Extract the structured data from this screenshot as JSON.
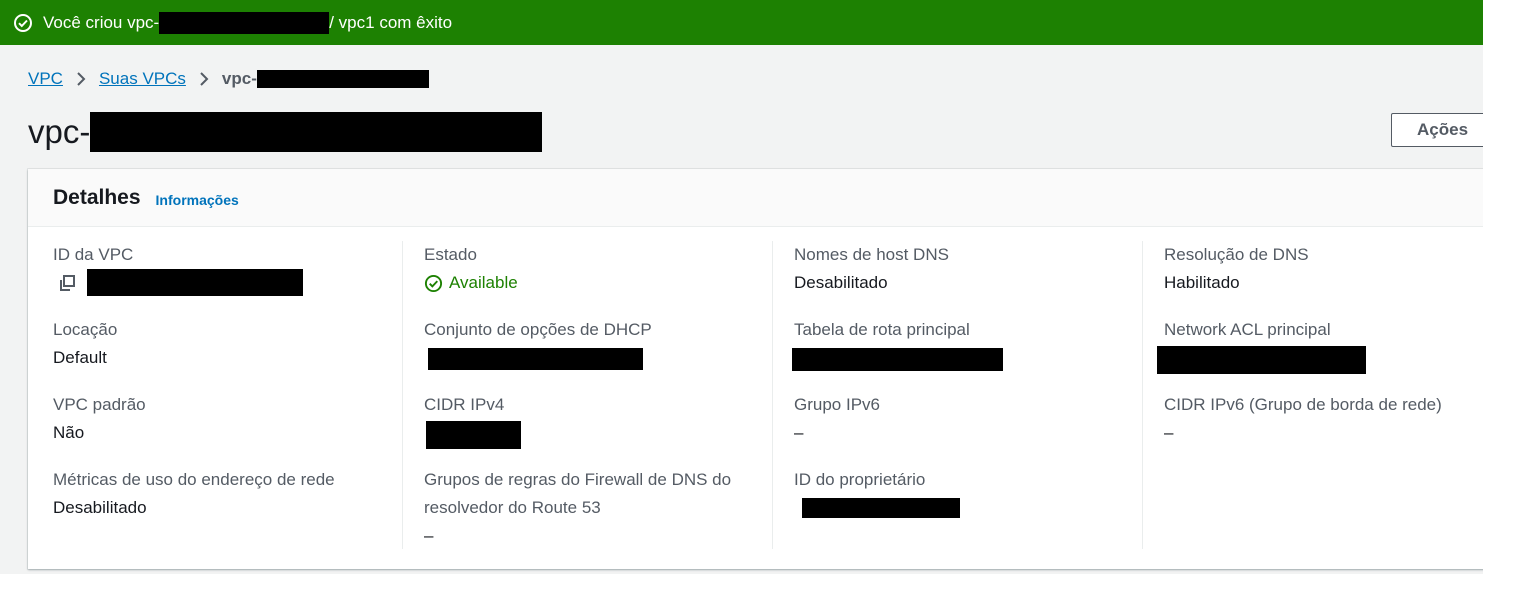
{
  "flash": {
    "prefix": "Você criou vpc-",
    "suffix": "/ vpc1 com êxito",
    "icon": "check-circle-icon",
    "background": "#1d8102"
  },
  "breadcrumb": {
    "items": [
      "VPC",
      "Suas VPCs"
    ],
    "current_prefix": "vpc-"
  },
  "page": {
    "title_prefix": "vpc-",
    "actions_label": "Ações"
  },
  "details": {
    "heading": "Detalhes",
    "info_link": "Informações",
    "fields": {
      "vpc_id": {
        "label": "ID da VPC"
      },
      "tenancy": {
        "label": "Locação",
        "value": "Default"
      },
      "default_vpc": {
        "label": "VPC padrão",
        "value": "Não"
      },
      "usage_metrics": {
        "label": "Métricas de uso do endereço de rede",
        "value": "Desabilitado"
      },
      "state": {
        "label": "Estado",
        "value": "Available",
        "color": "#1d8102"
      },
      "dhcp_options": {
        "label": "Conjunto de opções de DHCP"
      },
      "cidr_ipv4": {
        "label": "CIDR IPv4"
      },
      "route53_firewall": {
        "label": "Grupos de regras do Firewall de DNS do resolvedor do Route 53",
        "value": "–"
      },
      "dns_hostnames": {
        "label": "Nomes de host DNS",
        "value": "Desabilitado"
      },
      "main_route_table": {
        "label": "Tabela de rota principal"
      },
      "ipv6_pool": {
        "label": "Grupo IPv6",
        "value": "–"
      },
      "owner_id": {
        "label": "ID do proprietário"
      },
      "dns_resolution": {
        "label": "Resolução de DNS",
        "value": "Habilitado"
      },
      "main_network_acl": {
        "label": "Network ACL principal"
      },
      "cidr_ipv6": {
        "label": "CIDR IPv6 (Grupo de borda de rede)",
        "value": "–"
      }
    }
  },
  "colors": {
    "link": "#0073bb",
    "success": "#1d8102",
    "page_background": "#f2f3f3"
  }
}
